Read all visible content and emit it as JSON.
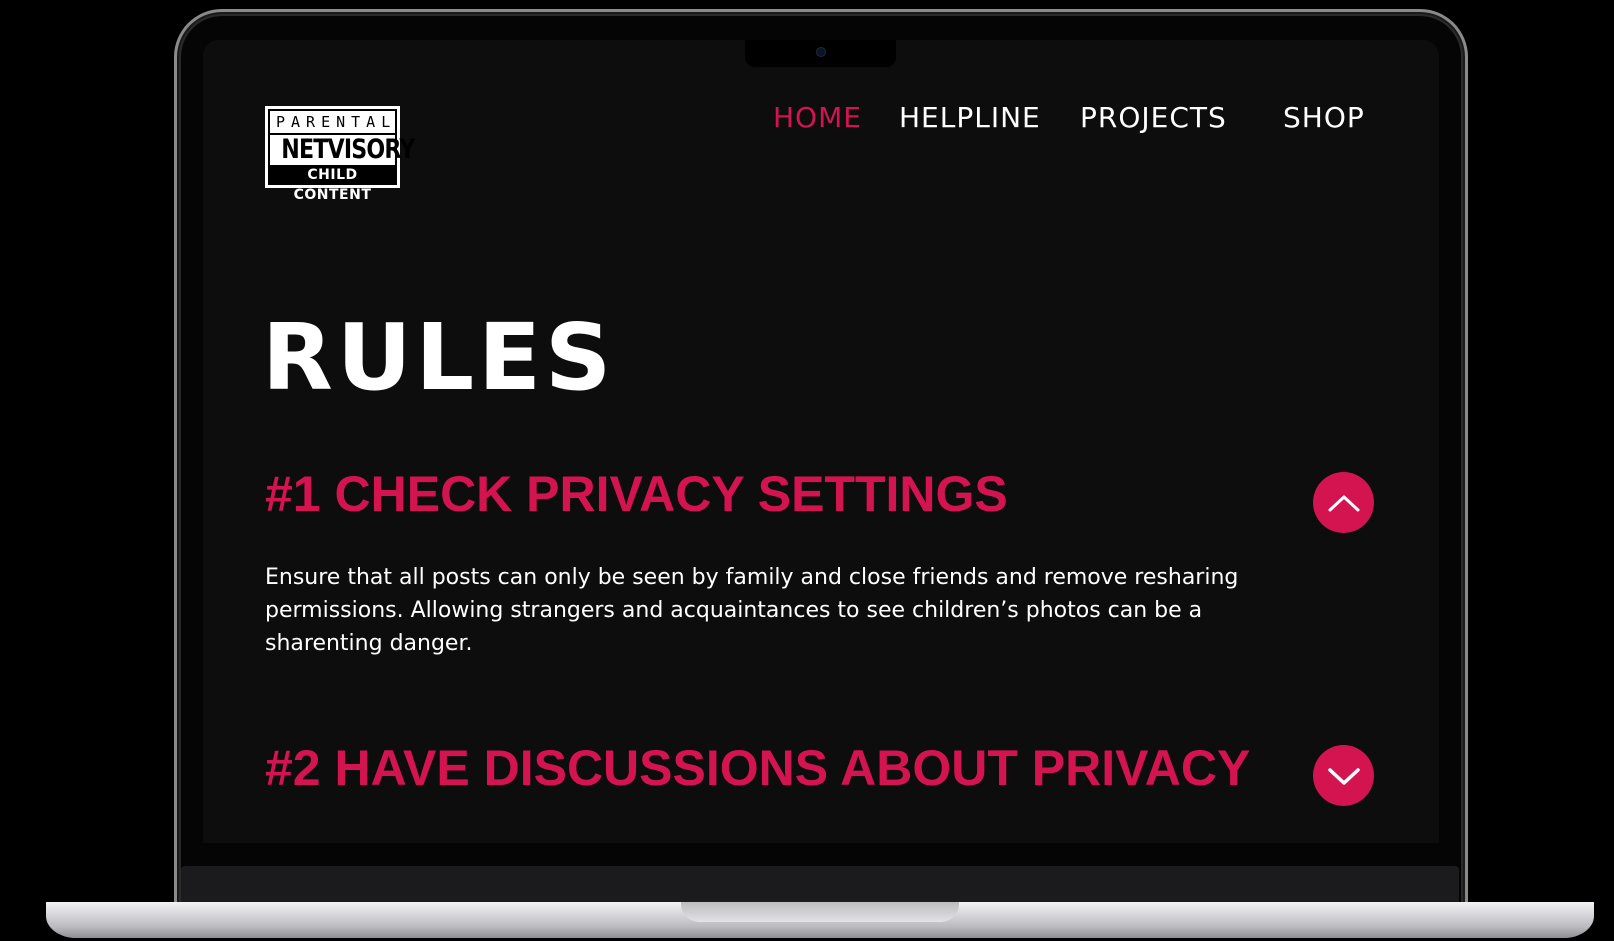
{
  "logo": {
    "top_text": "PARENTAL",
    "middle_text": "NETVISORY",
    "bottom_text": "CHILD CONTENT"
  },
  "nav": {
    "items": [
      {
        "label": "HOME",
        "active": true
      },
      {
        "label": "HELPLINE",
        "active": false
      },
      {
        "label": "PROJECTS",
        "active": false
      },
      {
        "label": "SHOP",
        "active": false
      }
    ]
  },
  "main": {
    "title": "RULES",
    "rules": [
      {
        "heading": "#1 CHECK PRIVACY SETTINGS",
        "body": "Ensure that all posts can only be seen by family and close friends and remove resharing permissions. Allowing strangers and acquaintances to see children’s photos can be a sharenting danger.",
        "expanded": true,
        "toggle_icon": "chevron-up-icon"
      },
      {
        "heading": "#2 HAVE DISCUSSIONS ABOUT PRIVACY",
        "body": "",
        "expanded": false,
        "toggle_icon": "chevron-down-icon"
      }
    ]
  },
  "colors": {
    "accent": "#d41450",
    "background": "#0d0d0d",
    "text": "#ffffff"
  }
}
